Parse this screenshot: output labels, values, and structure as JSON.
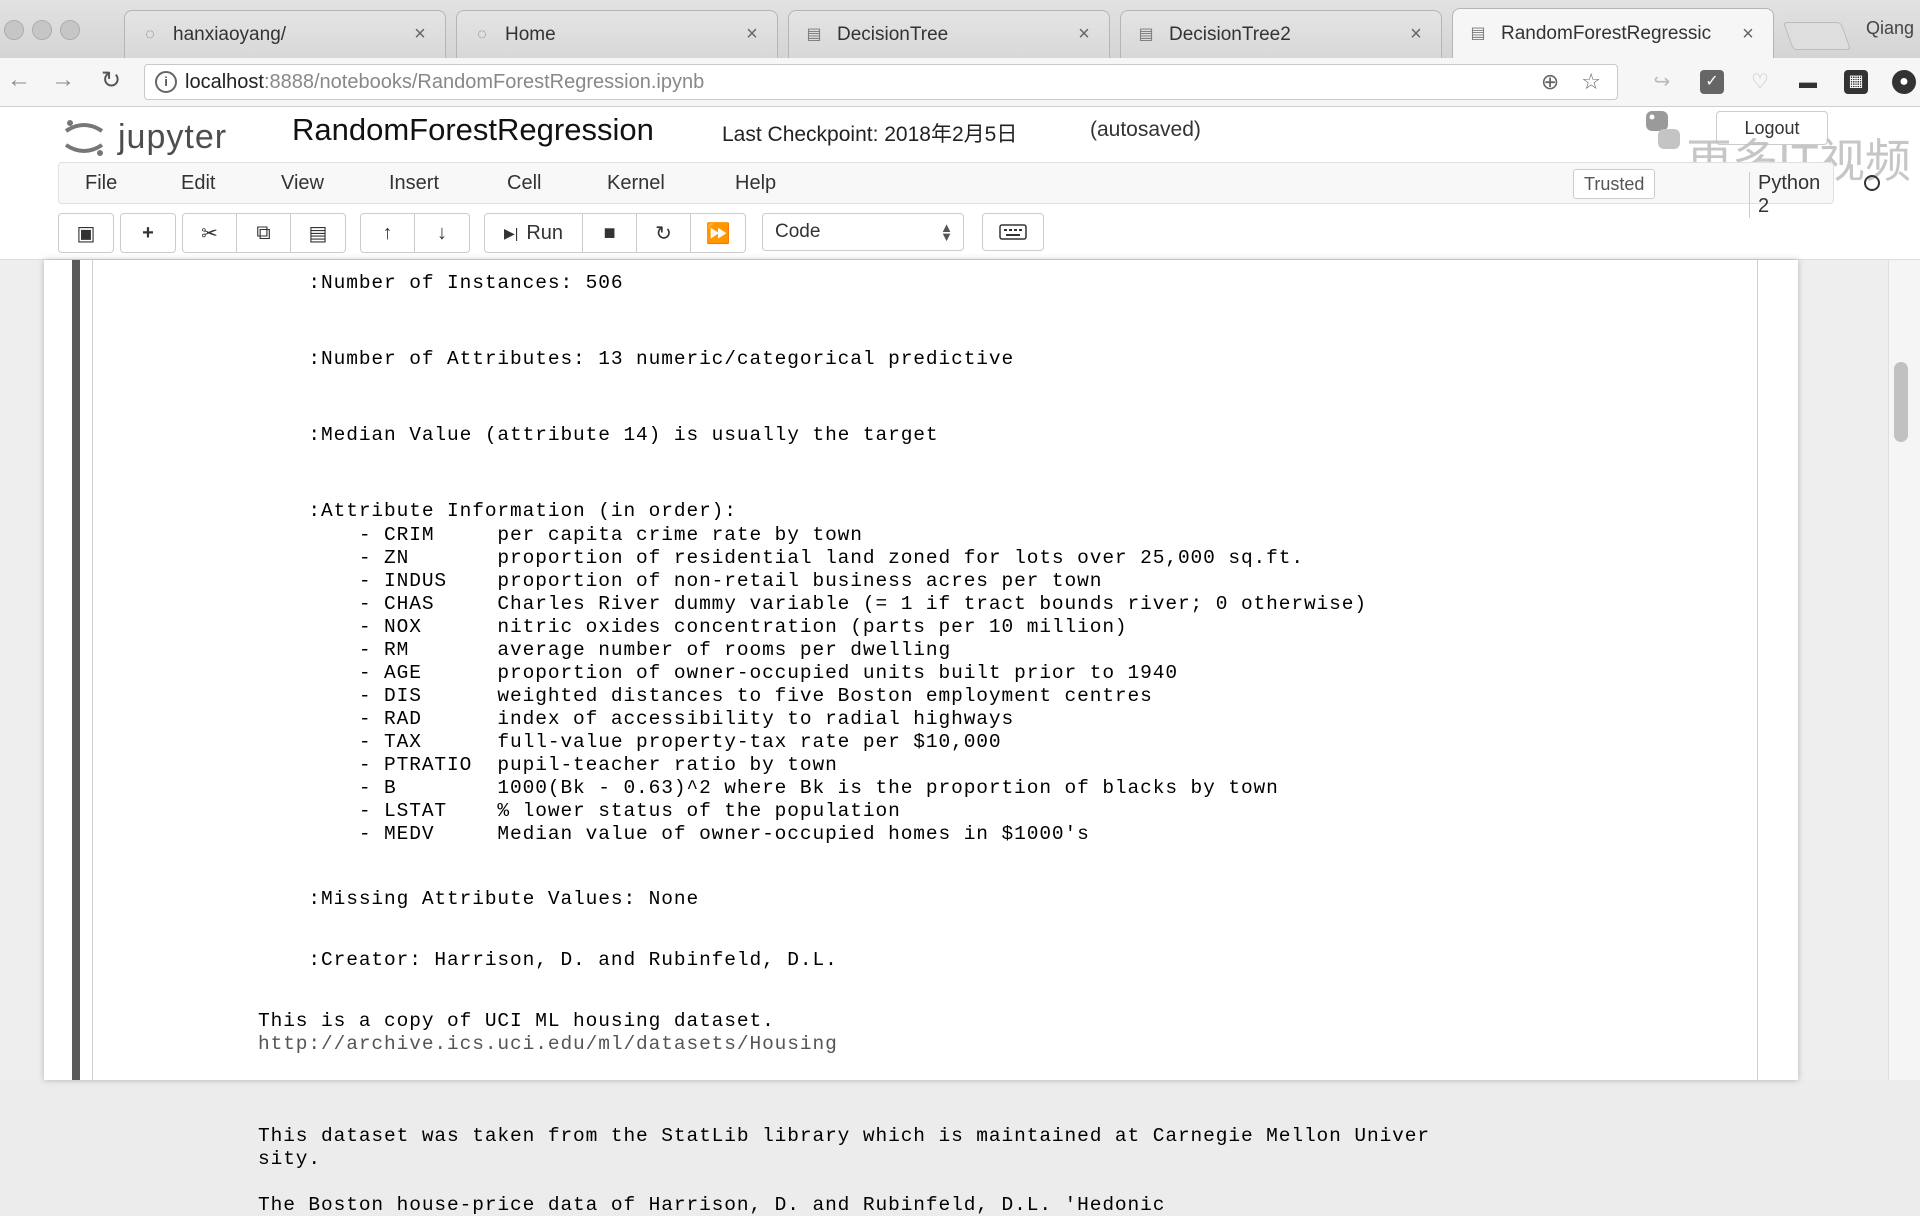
{
  "browser": {
    "tabs": [
      {
        "label": "hanxiaoyang/"
      },
      {
        "label": "Home"
      },
      {
        "label": "DecisionTree"
      },
      {
        "label": "DecisionTree2"
      },
      {
        "label": "RandomForestRegressic"
      }
    ],
    "close_glyph": "×",
    "profile_name": "Qiang",
    "url_host": "localhost",
    "url_path": ":8888/notebooks/RandomForestRegression.ipynb"
  },
  "jupyter": {
    "logo_text": "jupyter",
    "notebook_name": "RandomForestRegression",
    "checkpoint": "Last Checkpoint: 2018年2月5日",
    "autosave": "(autosaved)",
    "logout_label": "Logout",
    "watermark": "更多IT视频",
    "menu": [
      "File",
      "Edit",
      "View",
      "Insert",
      "Cell",
      "Kernel",
      "Help"
    ],
    "trusted_label": "Trusted",
    "kernel_name": "Python 2",
    "toolbar": {
      "run_label": "Run",
      "cell_type": "Code"
    }
  },
  "output_lines": [
    "    :Number of Instances: 506",
    "",
    "    :Number of Attributes: 13 numeric/categorical predictive",
    "",
    "    :Median Value (attribute 14) is usually the target",
    "",
    "    :Attribute Information (in order):",
    "        - CRIM     per capita crime rate by town",
    "        - ZN       proportion of residential land zoned for lots over 25,000 sq.ft.",
    "        - INDUS    proportion of non-retail business acres per town",
    "        - CHAS     Charles River dummy variable (= 1 if tract bounds river; 0 otherwise)",
    "        - NOX      nitric oxides concentration (parts per 10 million)",
    "        - RM       average number of rooms per dwelling",
    "        - AGE      proportion of owner-occupied units built prior to 1940",
    "        - DIS      weighted distances to five Boston employment centres",
    "        - RAD      index of accessibility to radial highways",
    "        - TAX      full-value property-tax rate per $10,000",
    "        - PTRATIO  pupil-teacher ratio by town",
    "        - B        1000(Bk - 0.63)^2 where Bk is the proportion of blacks by town",
    "        - LSTAT    % lower status of the population",
    "        - MEDV     Median value of owner-occupied homes in $1000's",
    "",
    "    :Missing Attribute Values: None",
    "",
    "    :Creator: Harrison, D. and Rubinfeld, D.L.",
    "",
    "This is a copy of UCI ML housing dataset.",
    "http://archive.ics.uci.edu/ml/datasets/Housing",
    "",
    "",
    "This dataset was taken from the StatLib library which is maintained at Carnegie Mellon Univer",
    "sity.",
    "",
    "The Boston house-price data of Harrison, D. and Rubinfeld, D.L. 'Hedonic"
  ],
  "link_line_index": 27
}
